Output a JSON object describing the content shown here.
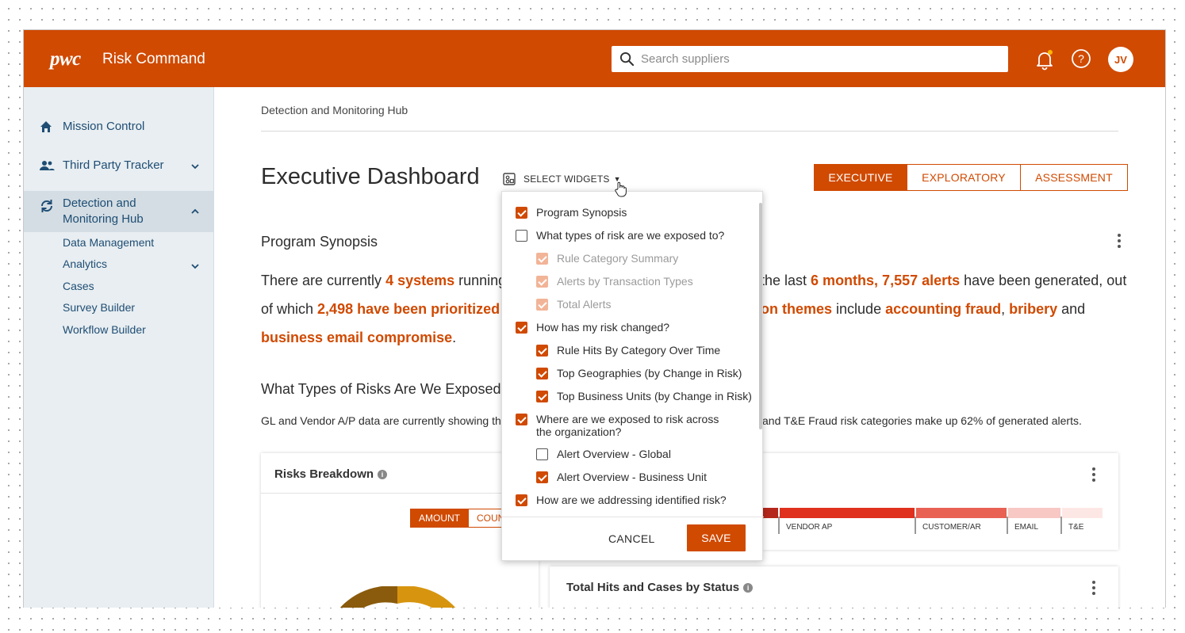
{
  "header": {
    "logo": "pwc",
    "app_name": "Risk Command",
    "search_placeholder": "Search suppliers",
    "user_initials": "JV",
    "accent_color": "#d04a02"
  },
  "sidebar": {
    "items": [
      {
        "label": "Mission Control",
        "icon": "home-icon"
      },
      {
        "label": "Third Party Tracker",
        "icon": "people-icon"
      },
      {
        "label_line1": "Detection and",
        "label_line2": "Monitoring Hub",
        "icon": "sync-icon"
      }
    ],
    "subitems": [
      "Data Management",
      "Analytics",
      "Cases",
      "Survey Builder",
      "Workflow Builder"
    ]
  },
  "breadcrumb": "Detection and Monitoring Hub",
  "page_title": "Executive Dashboard",
  "select_widgets_label": "SELECT WIDGETS",
  "tabs": [
    "EXECUTIVE",
    "EXPLORATORY",
    "ASSESSMENT"
  ],
  "synopsis": {
    "title": "Program Synopsis",
    "l1_a": "There are currently ",
    "l1_b": "4 systems",
    "l1_c": " running",
    "l1_d": "the last ",
    "l1_e": "6 months, 7,557 alerts",
    "l1_f": " have been generated, out",
    "l2_a": "of which ",
    "l2_b": "2,498 have been prioritized",
    "l2_c": "on themes",
    "l2_d": " include ",
    "l2_e": "accounting fraud",
    "l2_f": ", ",
    "l2_g": "bribery",
    "l2_h": " and",
    "l3_a": "business email compromise",
    "l3_b": "."
  },
  "risk_section": {
    "title": "What Types of Risks Are We Exposed",
    "desc_a": "GL and Vendor A/P data are currently showing th",
    "desc_b": "and T&E Fraud risk categories make up 62% of generated alerts."
  },
  "risks_breakdown": {
    "title": "Risks Breakdown",
    "toggle_on": "AMOUNT",
    "toggle_off": "COUNT"
  },
  "bar_labels": [
    "VENDOR AP",
    "CUSTOMER/AR",
    "EMAIL",
    "T&E"
  ],
  "total_hits": {
    "title": "Total Hits and Cases by Status"
  },
  "widget_dropdown": {
    "options": [
      {
        "label": "Program Synopsis",
        "state": "checked"
      },
      {
        "label": "What types of risk are we exposed to?",
        "state": "unchecked"
      },
      {
        "label": "Rule Category Summary",
        "state": "disabled"
      },
      {
        "label": "Alerts by Transaction Types",
        "state": "disabled"
      },
      {
        "label": "Total Alerts",
        "state": "disabled"
      },
      {
        "label": "How has my risk changed?",
        "state": "checked"
      },
      {
        "label": "Rule Hits By Category Over Time",
        "state": "checked"
      },
      {
        "label": "Top Geographies (by Change in Risk)",
        "state": "checked"
      },
      {
        "label": "Top Business Units (by Change in Risk)",
        "state": "checked"
      },
      {
        "label_line1": "Where are we exposed to risk across",
        "label_line2": "the organization?",
        "state": "checked"
      },
      {
        "label": "Alert Overview - Global",
        "state": "unchecked"
      },
      {
        "label": "Alert Overview - Business Unit",
        "state": "checked"
      },
      {
        "label": "How are we addressing identified risk?",
        "state": "checked"
      }
    ],
    "cancel_label": "CANCEL",
    "save_label": "SAVE"
  }
}
